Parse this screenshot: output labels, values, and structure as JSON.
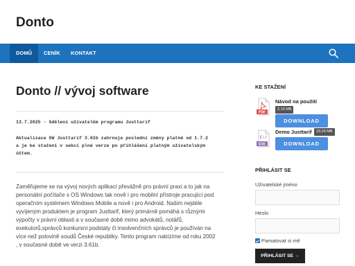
{
  "site": {
    "title": "Donto"
  },
  "nav": {
    "items": [
      {
        "label": "DOMŮ"
      },
      {
        "label": "CENÍK"
      },
      {
        "label": "KONTAKT"
      }
    ],
    "search_icon": "search-icon"
  },
  "main": {
    "title": "Donto // vývoj software",
    "post": {
      "date_line": "13.7.2025 - Sdělení uživatelům programu Justtarif",
      "lines": [
        "Aktualizace SW Justtarif 3.61b zahrnuje poslední změny platné od 1.7.2",
        "a je ke stažení v sekci plné verze po přihlášení platným uživatelským",
        "účtem."
      ]
    },
    "body_lines": [
      "Zaměřujeme se na vývoj nových aplikací převážně pro právní praxi a to jak na",
      "personální počítače s OS Windows tak nově i pro mobilní přístroje pracující pod",
      "operačním systémem Windows Mobile a nově i pro Android. Našim nejdéle",
      "vyvíjeným produktem je program Justtarif, který primárně pomáhá s různými",
      "výpočty v právní oblasti a v současné době mimo advokátů, notářů,",
      "exekutorů,správců konkursní podstaty či insolvenčních správců  je používán na",
      "více než polovině soudů České republiky. Tento program nabízíme od roku 2002",
      ", v současné době ve verzi 3.61b."
    ]
  },
  "sidebar": {
    "downloads": {
      "title": "KE STAŽENÍ",
      "items": [
        {
          "name": "Návod na použití",
          "size": "2,10 MB",
          "type": "PDF",
          "button": "DOWNLOAD"
        },
        {
          "name": "Demo Justtarif",
          "size": "19,24 MB",
          "type": "EXE",
          "button": "DOWNLOAD"
        }
      ]
    },
    "login": {
      "title": "PŘIHLÁSIT SE",
      "username_label": "Uživatelské jméno",
      "password_label": "Heslo",
      "remember_label": "Pamatovat si mě",
      "remember_checked": true,
      "button_label": "PŘIHLÁSIT SE →"
    }
  },
  "colors": {
    "nav": "#1e73be",
    "nav_active": "#0e5a9d",
    "button": "#4d8fe0",
    "pdf": "#d9534f"
  }
}
